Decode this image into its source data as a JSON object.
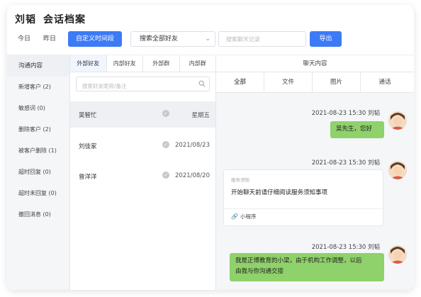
{
  "header": {
    "user": "刘韬",
    "title": "会话档案",
    "ranges": [
      "今日",
      "昨日",
      "自定义时间段"
    ],
    "friend_select": "搜索全部好友",
    "record_search_placeholder": "搜索聊天记录",
    "export_label": "导出"
  },
  "nav": {
    "items": [
      {
        "label": "沟通内容"
      },
      {
        "label": "新增客户 (2)"
      },
      {
        "label": "敏感词 (0)"
      },
      {
        "label": "删除客户 (2)"
      },
      {
        "label": "被客户删除 (1)"
      },
      {
        "label": "超时回复 (0)"
      },
      {
        "label": "超时未回复 (0)"
      },
      {
        "label": "撤回消息 (0)"
      }
    ]
  },
  "friends": {
    "tabs": [
      "外部好友",
      "内部好友",
      "外部群",
      "内部群"
    ],
    "search_placeholder": "搜索好友昵称/备注",
    "contacts": [
      {
        "name": "吴智忙",
        "date": "星期五"
      },
      {
        "name": "刘佳家",
        "date": "2021/08/23"
      },
      {
        "name": "曾洋洋",
        "date": "2021/08/20"
      }
    ]
  },
  "chat": {
    "title": "聊天内容",
    "tabs": [
      "全部",
      "文件",
      "图片",
      "通话"
    ],
    "messages": [
      {
        "meta": "2021-08-23 15:30 刘韬",
        "text": "吴先生，您好"
      },
      {
        "meta": "2021-08-23 15:30 刘韬",
        "mini_label": "服务须知",
        "mini_text": "开始聊天前请仔细阅读服务须知事项",
        "mini_foot": "小程序",
        "mini_icon": "link-icon"
      },
      {
        "meta": "2021-08-23 15:30 刘韬",
        "line1": "我是正博教育的小梁，由于机构工作调整，以后",
        "line2": "由我与你沟通交接"
      }
    ]
  },
  "colors": {
    "accent": "#3d7af5",
    "bubble": "#8fd16a"
  }
}
